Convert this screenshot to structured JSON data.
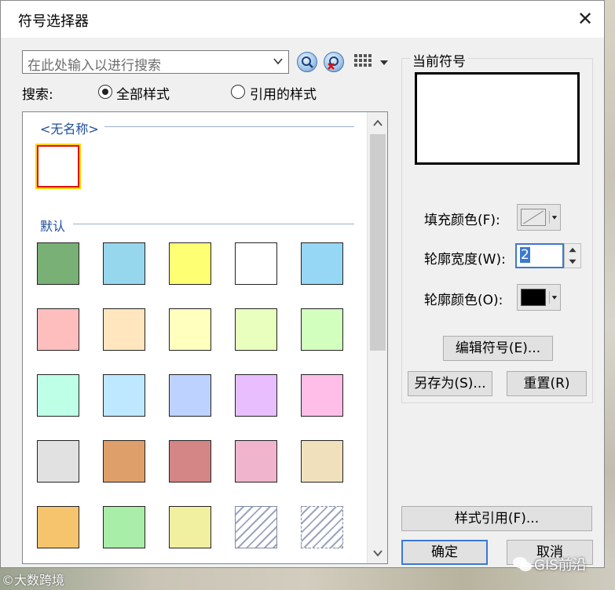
{
  "window": {
    "title": "符号选择器",
    "close_glyph": "✕"
  },
  "search": {
    "placeholder": "在此处输入以进行搜索",
    "label": "搜索:",
    "options": [
      {
        "label": "全部样式",
        "checked": true
      },
      {
        "label": "引用的样式",
        "checked": false
      }
    ]
  },
  "gallery": {
    "groups": [
      {
        "name": "<无名称>",
        "items": [
          {
            "fill": "#ffffff",
            "selected": true
          }
        ]
      },
      {
        "name": "默认",
        "items": [
          {
            "fill": "#78b075"
          },
          {
            "fill": "#96d7ee"
          },
          {
            "fill": "#ffff73"
          },
          {
            "fill": "#ffffff"
          },
          {
            "fill": "#96d7f5"
          },
          {
            "fill": "#ffbebe"
          },
          {
            "fill": "#ffe6be"
          },
          {
            "fill": "#ffffbe"
          },
          {
            "fill": "#e9ffbe"
          },
          {
            "fill": "#d2ffbe"
          },
          {
            "fill": "#beffe8"
          },
          {
            "fill": "#bee8ff"
          },
          {
            "fill": "#bed2ff"
          },
          {
            "fill": "#e8beff"
          },
          {
            "fill": "#ffbee8"
          },
          {
            "fill": "#e1e1e1"
          },
          {
            "fill": "#de9f6a"
          },
          {
            "fill": "#d48585"
          },
          {
            "fill": "#f0b4cc"
          },
          {
            "fill": "#f0e1bc"
          },
          {
            "fill": "#f5c46c"
          },
          {
            "fill": "#a8eda8"
          },
          {
            "fill": "#f0f0a0"
          },
          {
            "fill": "hatch"
          },
          {
            "fill": "hatch-dashed"
          }
        ]
      }
    ]
  },
  "current_symbol": {
    "label": "当前符号",
    "fill_color_label": "填充颜色(F):",
    "outline_width_label": "轮廓宽度(W):",
    "outline_width_value": "2",
    "outline_color_label": "轮廓颜色(O):",
    "outline_color": "#000000"
  },
  "buttons": {
    "edit_symbol": "编辑符号(E)...",
    "save_as": "另存为(S)...",
    "reset": "重置(R)",
    "style_references": "样式引用(F)...",
    "ok": "确定",
    "cancel": "取消"
  },
  "watermarks": {
    "left": "©大数跨境",
    "right": "GIS前沿"
  }
}
